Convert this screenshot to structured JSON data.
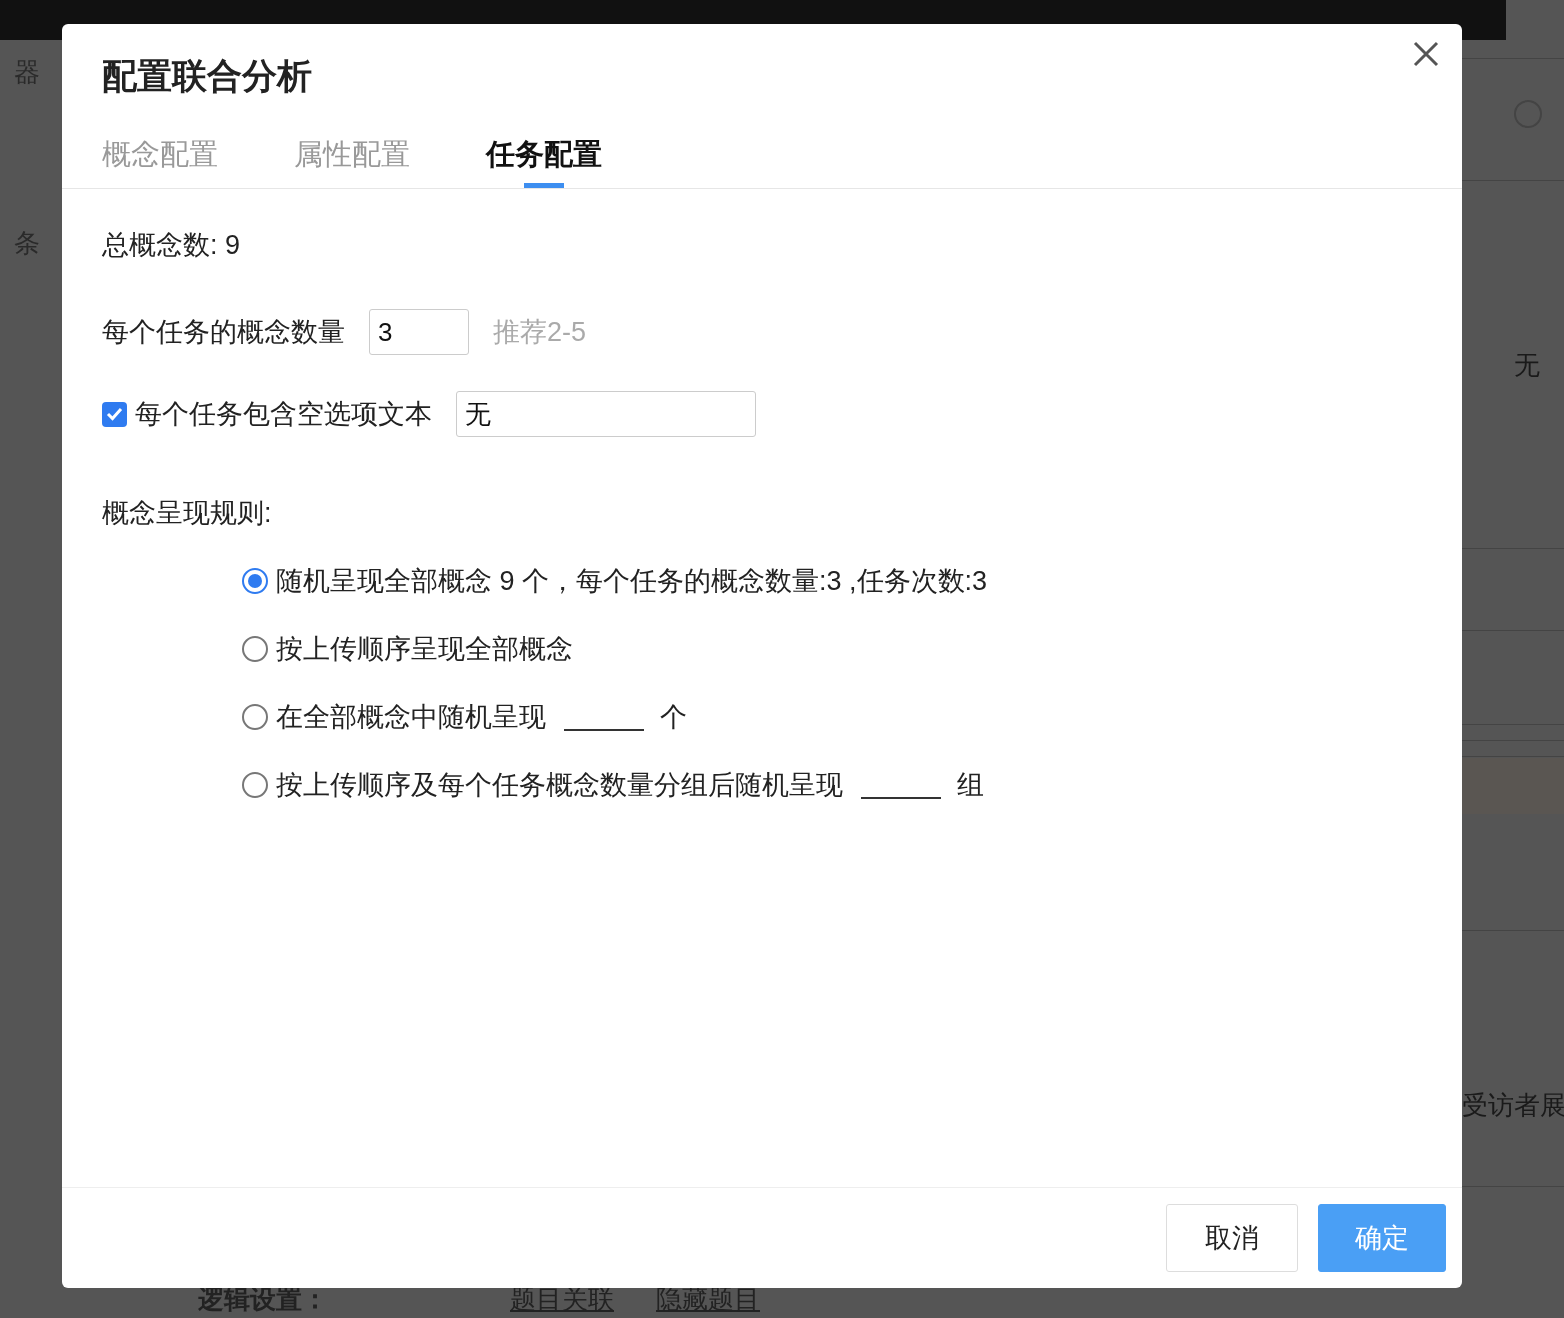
{
  "background": {
    "left_items": [
      "器",
      "条"
    ],
    "right_items": [
      "无",
      "受访者展"
    ],
    "footer": {
      "label": "逻辑设置：",
      "links": [
        "题目关联",
        "隐藏题目"
      ]
    }
  },
  "dialog": {
    "title": "配置联合分析",
    "tabs": [
      {
        "label": "概念配置",
        "selected": false
      },
      {
        "label": "属性配置",
        "selected": false
      },
      {
        "label": "任务配置",
        "selected": true
      }
    ],
    "total": "总概念数: 9",
    "per_task": {
      "label": "每个任务的概念数量",
      "value": "3",
      "hint": "推荐2-5"
    },
    "empty_option": {
      "label": "每个任务包含空选项文本",
      "checked": true,
      "value": "无"
    },
    "rule_title": "概念呈现规则:",
    "rules": [
      {
        "kind": "text",
        "label": "随机呈现全部概念 9 个，每个任务的概念数量:3 ,任务次数:3",
        "selected": true
      },
      {
        "kind": "text",
        "label": "按上传顺序呈现全部概念",
        "selected": false
      },
      {
        "kind": "blank",
        "label": "在全部概念中随机呈现",
        "suffix": "个",
        "selected": false
      },
      {
        "kind": "blank",
        "label": "按上传顺序及每个任务概念数量分组后随机呈现",
        "suffix": "组",
        "selected": false
      }
    ],
    "buttons": [
      {
        "label": "取消",
        "kind": "default"
      },
      {
        "label": "确定",
        "kind": "primary"
      }
    ]
  }
}
